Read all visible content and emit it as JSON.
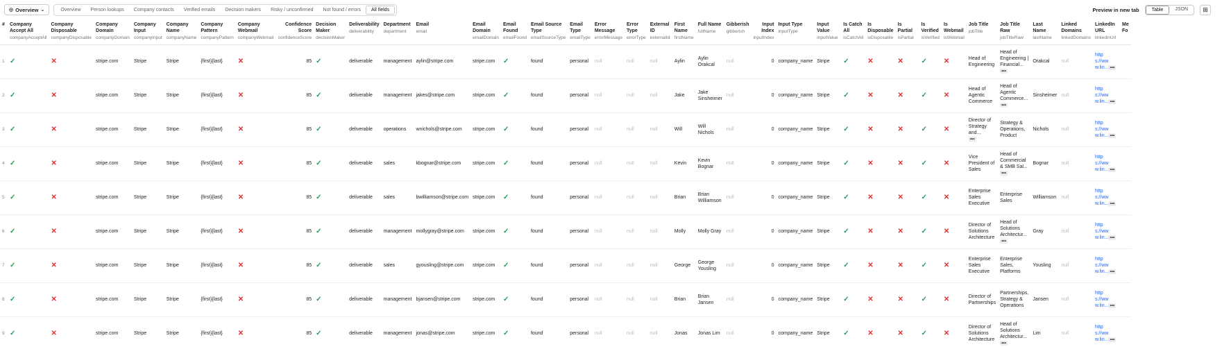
{
  "toolbar": {
    "view_label": "Overview",
    "view_icon": "eye-icon",
    "tabs": [
      "Overview",
      "Person lookups",
      "Company contacts",
      "Verified emails",
      "Decision makers",
      "Risky / unconfirmed",
      "Not found / errors",
      "All fields"
    ],
    "active_tab": "All fields",
    "preview_label": "Preview in new tab",
    "format_toggle": [
      "Table",
      "JSON"
    ],
    "active_format": "Table",
    "colors": {
      "check": "#1f9d55",
      "cross": "#e03131",
      "link": "#2563eb"
    }
  },
  "columns": [
    {
      "title": "#",
      "sub": ""
    },
    {
      "title": "Company Accept All",
      "sub": "companyAcceptAll"
    },
    {
      "title": "Company Disposable",
      "sub": "companyDisposable"
    },
    {
      "title": "Company Domain",
      "sub": "companyDomain"
    },
    {
      "title": "Company Input",
      "sub": "companyInput"
    },
    {
      "title": "Company Name",
      "sub": "companyName"
    },
    {
      "title": "Company Pattern",
      "sub": "companyPattern"
    },
    {
      "title": "Company Webmail",
      "sub": "companyWebmail"
    },
    {
      "title": "Confidence Score",
      "sub": "confidenceScore"
    },
    {
      "title": "Decision Maker",
      "sub": "decisionMaker"
    },
    {
      "title": "Deliverability",
      "sub": "deliverability"
    },
    {
      "title": "Department",
      "sub": "department"
    },
    {
      "title": "Email",
      "sub": "email"
    },
    {
      "title": "Email Domain",
      "sub": "emailDomain"
    },
    {
      "title": "Email Found",
      "sub": "emailFound"
    },
    {
      "title": "Email Source Type",
      "sub": "emailSourceType"
    },
    {
      "title": "Email Type",
      "sub": "emailType"
    },
    {
      "title": "Error Message",
      "sub": "errorMessage"
    },
    {
      "title": "Error Type",
      "sub": "errorType"
    },
    {
      "title": "External ID",
      "sub": "externalId"
    },
    {
      "title": "First Name",
      "sub": "firstName"
    },
    {
      "title": "Full Name",
      "sub": "fullName"
    },
    {
      "title": "Gibberish",
      "sub": "gibberish"
    },
    {
      "title": "Input Index",
      "sub": "inputIndex"
    },
    {
      "title": "Input Type",
      "sub": "inputType"
    },
    {
      "title": "Input Value",
      "sub": "inputValue"
    },
    {
      "title": "Is Catch All",
      "sub": "isCatchAll"
    },
    {
      "title": "Is Disposable",
      "sub": "isDisposable"
    },
    {
      "title": "Is Partial",
      "sub": "isPartial"
    },
    {
      "title": "Is Verified",
      "sub": "isVerified"
    },
    {
      "title": "Is Webmail",
      "sub": "isWebmail"
    },
    {
      "title": "Job Title",
      "sub": "jobTitle"
    },
    {
      "title": "Job Title Raw",
      "sub": "jobTitleRaw"
    },
    {
      "title": "Last Name",
      "sub": "lastName"
    },
    {
      "title": "Linked Domains",
      "sub": "linkedDomains"
    },
    {
      "title": "LinkedIn URL",
      "sub": "linkedinUrl"
    },
    {
      "title": "Me Fo",
      "sub": ""
    }
  ],
  "common": {
    "domain": "stripe.com",
    "company": "Stripe",
    "pattern": "{first}{last}",
    "score": "85",
    "deliverability": "deliverable",
    "source": "found",
    "email_type": "personal",
    "null": "null",
    "input_index": "0",
    "input_type": "company_name",
    "input_value": "Stripe",
    "url": "http s://ww w.lin...",
    "more": "•••"
  },
  "rows": [
    {
      "n": "1",
      "dept": "management",
      "email": "aylin@stripe.com",
      "first": "Aylin",
      "full": "Aylin Orakcal",
      "job": "Head of Engineering",
      "jobraw": "Head of Engineering | Financial...",
      "last": "Orakcal",
      "job_more": false,
      "raw_more": true
    },
    {
      "n": "2",
      "dept": "management",
      "email": "jakes@stripe.com",
      "first": "Jake",
      "full": "Jake Sinsheimer",
      "job": "Head of Agentic Commerce",
      "jobraw": "Head of Agentic Commerce...",
      "last": "Sinsheimer",
      "job_more": false,
      "raw_more": true
    },
    {
      "n": "3",
      "dept": "operations",
      "email": "wnichols@stripe.com",
      "first": "Will",
      "full": "Will Nichols",
      "job": "Director of Strategy and...",
      "jobraw": "Strategy & Operations, Product",
      "last": "Nichols",
      "job_more": true,
      "raw_more": false
    },
    {
      "n": "4",
      "dept": "sales",
      "email": "kbognar@stripe.com",
      "first": "Kevin",
      "full": "Kevin Bognar",
      "job": "Vice President of Sales",
      "jobraw": "Head of Commercial & SMB Sal...",
      "last": "Bognar",
      "job_more": false,
      "raw_more": true
    },
    {
      "n": "5",
      "dept": "sales",
      "email": "bwilliamson@stripe.com",
      "first": "Brian",
      "full": "Brian Williamson",
      "job": "Enterprise Sales Executive",
      "jobraw": "Enterprise Sales",
      "last": "Williamson",
      "job_more": false,
      "raw_more": false
    },
    {
      "n": "6",
      "dept": "management",
      "email": "mollygray@stripe.com",
      "first": "Molly",
      "full": "Molly Gray",
      "job": "Director of Solutions Architecture",
      "jobraw": "Head of Solutions Architectur...",
      "last": "Gray",
      "job_more": false,
      "raw_more": true
    },
    {
      "n": "7",
      "dept": "sales",
      "email": "gyousling@stripe.com",
      "first": "George",
      "full": "George Yousling",
      "job": "Enterprise Sales Executive",
      "jobraw": "Enterprise Sales, Platforms",
      "last": "Yousling",
      "job_more": false,
      "raw_more": false
    },
    {
      "n": "8",
      "dept": "management",
      "email": "bjansen@stripe.com",
      "first": "Brian",
      "full": "Brian Jansen",
      "job": "Director of Partnerships",
      "jobraw": "Partnerships, Strategy & Operations",
      "last": "Jansen",
      "job_more": false,
      "raw_more": false
    },
    {
      "n": "9",
      "dept": "management",
      "email": "jonas@stripe.com",
      "first": "Jonas",
      "full": "Jonas Lim",
      "job": "Director of Solutions Architecture",
      "jobraw": "Head of Solutions Architectur...",
      "last": "Lim",
      "job_more": false,
      "raw_more": true
    }
  ]
}
